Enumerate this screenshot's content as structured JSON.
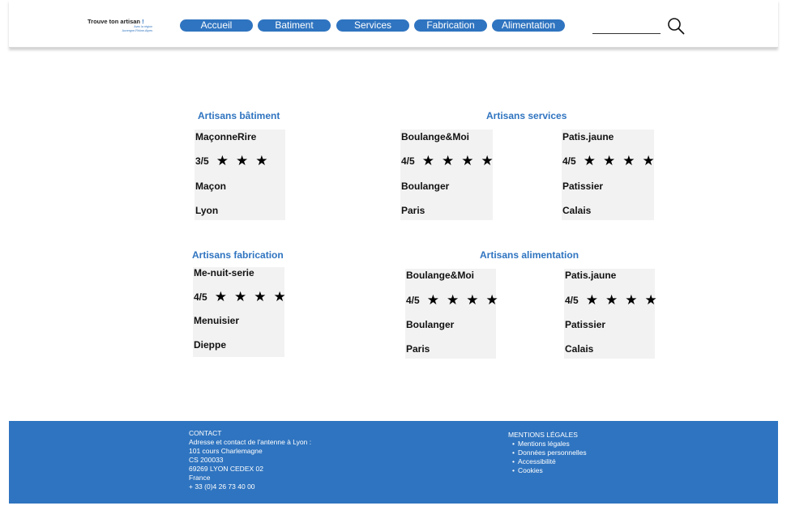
{
  "header": {
    "logo_main": "Trouve ton artisan ",
    "logo_bang": "!",
    "logo_sub1": "Avec la région",
    "logo_sub2": "Auvergne-Rhône-Alpes",
    "nav": [
      "Accueil",
      "Batiment",
      "Services",
      "Fabrication",
      "Alimentation"
    ],
    "search_icon": "search-icon"
  },
  "sections": {
    "batiment": {
      "title": "Artisans bâtiment",
      "cards": [
        {
          "name": "MaçonneRire",
          "rating": "3/5",
          "stars": 3,
          "job": "Maçon",
          "city": "Lyon"
        }
      ]
    },
    "services": {
      "title": "Artisans services",
      "cards": [
        {
          "name": "Boulange&Moi",
          "rating": "4/5",
          "stars": 4,
          "job": "Boulanger",
          "city": "Paris"
        },
        {
          "name": "Patis.jaune",
          "rating": "4/5",
          "stars": 4,
          "job": "Patissier",
          "city": "Calais"
        }
      ]
    },
    "fabrication": {
      "title": "Artisans fabrication",
      "cards": [
        {
          "name": "Me-nuit-serie",
          "rating": "4/5",
          "stars": 4,
          "job": "Menuisier",
          "city": "Dieppe"
        }
      ]
    },
    "alimentation": {
      "title": "Artisans alimentation",
      "cards": [
        {
          "name": "Boulange&Moi",
          "rating": "4/5",
          "stars": 4,
          "job": "Boulanger",
          "city": "Paris"
        },
        {
          "name": "Patis.jaune",
          "rating": "4/5",
          "stars": 4,
          "job": "Patissier",
          "city": "Calais"
        }
      ]
    }
  },
  "footer": {
    "contact_title": "CONTACT",
    "contact_lines": [
      "Adresse et contact de l'antenne à Lyon :",
      "101 cours Charlemagne",
      "CS 200033",
      "69269 LYON CEDEX 02",
      "France",
      "+ 33 (0)4 26 73 40 00"
    ],
    "legal_title": "MENTIONS LÉGALES",
    "legal_links": [
      "Mentions légales",
      "Données personnelles",
      "Accessibilité",
      "Cookies"
    ]
  },
  "colors": {
    "accent": "#2f74c0",
    "card_bg": "#f2f2f2"
  }
}
